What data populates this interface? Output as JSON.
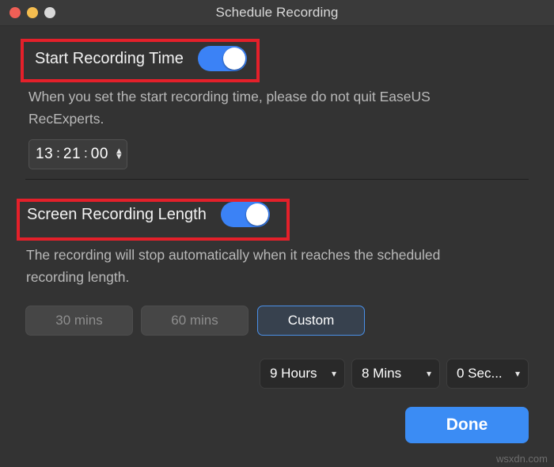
{
  "window": {
    "title": "Schedule Recording",
    "traffic_lights": [
      {
        "name": "close",
        "color": "#ef5f56"
      },
      {
        "name": "minimize",
        "color": "#f5bd4f"
      },
      {
        "name": "zoom",
        "color": "#d8d8d8"
      }
    ],
    "background": "#333333",
    "titlebar_background": "#3a3a3a"
  },
  "start_recording": {
    "label": "Start Recording Time",
    "toggle_on": true,
    "toggle_color": "#3b82f6",
    "description": "When you set the start recording time, please do not quit EaseUS RecExperts.",
    "time": {
      "hours": "13",
      "minutes": "21",
      "seconds": "00",
      "separator": ":",
      "stepper_up": "▲",
      "stepper_down": "▼"
    }
  },
  "screen_recording_length": {
    "label": "Screen Recording Length",
    "toggle_on": true,
    "toggle_color": "#3b82f6",
    "description": "The recording will stop automatically when it reaches the scheduled recording length.",
    "presets": [
      {
        "label": "30 mins",
        "state": "disabled"
      },
      {
        "label": "60 mins",
        "state": "disabled"
      },
      {
        "label": "Custom",
        "state": "selected"
      }
    ],
    "selected_border_color": "#4a90e8",
    "duration": [
      {
        "name": "hours",
        "value": "9 Hours",
        "chevron": "⌄"
      },
      {
        "name": "minutes",
        "value": "8 Mins",
        "chevron": "⌄"
      },
      {
        "name": "seconds",
        "value": "0 Sec...",
        "chevron": "⌄"
      }
    ]
  },
  "footer": {
    "done_label": "Done",
    "done_color": "#3b8cf4",
    "watermark": "wsxdn.com"
  },
  "annotations": {
    "highlight_color": "#e4202a",
    "boxes": [
      {
        "name": "start-recording-time-highlight"
      },
      {
        "name": "screen-recording-length-highlight"
      }
    ]
  }
}
